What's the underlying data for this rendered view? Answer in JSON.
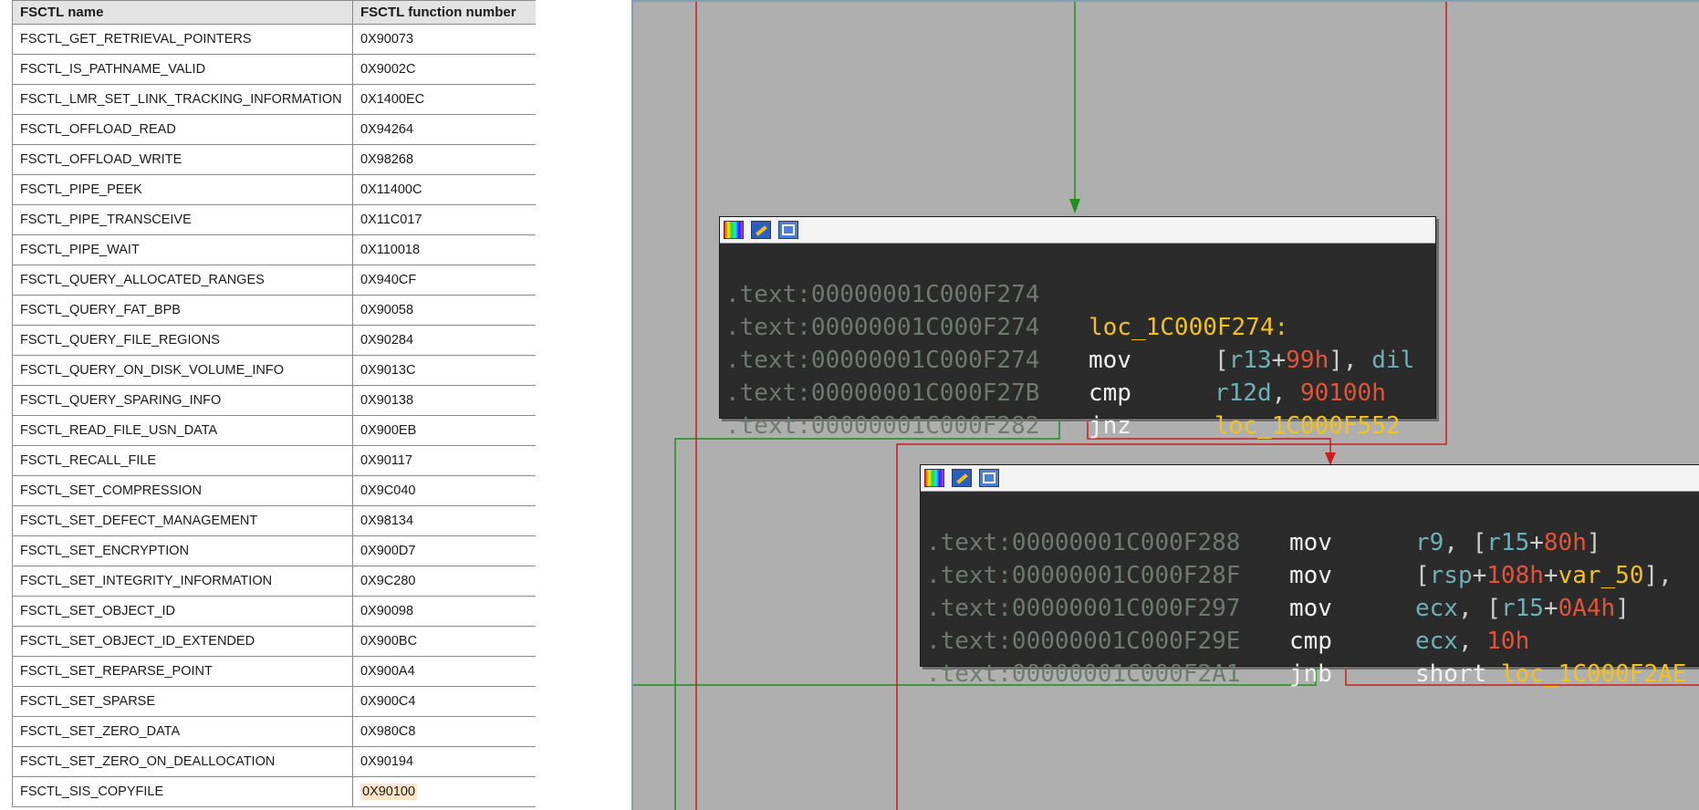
{
  "table": {
    "headers": [
      "FSCTL name",
      "FSCTL function number"
    ],
    "rows": [
      [
        "FSCTL_GET_RETRIEVAL_POINTERS",
        "0X90073"
      ],
      [
        "FSCTL_IS_PATHNAME_VALID",
        "0X9002C"
      ],
      [
        "FSCTL_LMR_SET_LINK_TRACKING_INFORMATION",
        "0X1400EC"
      ],
      [
        "FSCTL_OFFLOAD_READ",
        "0X94264"
      ],
      [
        "FSCTL_OFFLOAD_WRITE",
        "0X98268"
      ],
      [
        "FSCTL_PIPE_PEEK",
        "0X11400C"
      ],
      [
        "FSCTL_PIPE_TRANSCEIVE",
        "0X11C017"
      ],
      [
        "FSCTL_PIPE_WAIT",
        "0X110018"
      ],
      [
        "FSCTL_QUERY_ALLOCATED_RANGES",
        "0X940CF"
      ],
      [
        "FSCTL_QUERY_FAT_BPB",
        "0X90058"
      ],
      [
        "FSCTL_QUERY_FILE_REGIONS",
        "0X90284"
      ],
      [
        "FSCTL_QUERY_ON_DISK_VOLUME_INFO",
        "0X9013C"
      ],
      [
        "FSCTL_QUERY_SPARING_INFO",
        "0X90138"
      ],
      [
        "FSCTL_READ_FILE_USN_DATA",
        "0X900EB"
      ],
      [
        "FSCTL_RECALL_FILE",
        "0X90117"
      ],
      [
        "FSCTL_SET_COMPRESSION",
        "0X9C040"
      ],
      [
        "FSCTL_SET_DEFECT_MANAGEMENT",
        "0X98134"
      ],
      [
        "FSCTL_SET_ENCRYPTION",
        "0X900D7"
      ],
      [
        "FSCTL_SET_INTEGRITY_INFORMATION",
        "0X9C280"
      ],
      [
        "FSCTL_SET_OBJECT_ID",
        "0X90098"
      ],
      [
        "FSCTL_SET_OBJECT_ID_EXTENDED",
        "0X900BC"
      ],
      [
        "FSCTL_SET_REPARSE_POINT",
        "0X900A4"
      ],
      [
        "FSCTL_SET_SPARSE",
        "0X900C4"
      ],
      [
        "FSCTL_SET_ZERO_DATA",
        "0X980C8"
      ],
      [
        "FSCTL_SET_ZERO_ON_DEALLOCATION",
        "0X90194"
      ],
      [
        "FSCTL_SIS_COPYFILE",
        "0X90100"
      ]
    ],
    "highlighted_value": "0X90100",
    "highlight_color": "#fde4c8"
  },
  "graph": {
    "background_color": "#afafaf",
    "edge_colors": {
      "true_branch": "#1f8f1f",
      "false_branch": "#c81e1e"
    },
    "header_icons": [
      "palette-icon",
      "edit-icon",
      "graph-view-icon"
    ],
    "node1": {
      "lines": [
        {
          "addr": ".text:00000001C000F274",
          "label": ""
        },
        {
          "addr": ".text:00000001C000F274",
          "label": "loc_1C000F274:"
        },
        {
          "addr": ".text:00000001C000F274",
          "mnem": "mov",
          "op_a": "[",
          "op_b": "r13",
          "op_c": "+",
          "op_d": "99h",
          "op_e": "], ",
          "op_f": "dil"
        },
        {
          "addr": ".text:00000001C000F27B",
          "mnem": "cmp",
          "op_a": "r12d",
          "op_b": ", ",
          "op_c": "90100h"
        },
        {
          "addr": ".text:00000001C000F282",
          "mnem": "jnz",
          "op_a": "loc_1C000F552"
        }
      ]
    },
    "node2": {
      "lines": [
        {
          "addr": ".text:00000001C000F288",
          "mnem": "mov",
          "op_a": "r9",
          "op_b": ", [",
          "op_c": "r15",
          "op_d": "+",
          "op_e": "80h",
          "op_f": "]"
        },
        {
          "addr": ".text:00000001C000F28F",
          "mnem": "mov",
          "op_a": "[",
          "op_b": "rsp",
          "op_c": "+",
          "op_d": "108h",
          "op_e": "+",
          "op_f": "var_50",
          "op_g": "],"
        },
        {
          "addr": ".text:00000001C000F297",
          "mnem": "mov",
          "op_a": "ecx",
          "op_b": ", [",
          "op_c": "r15",
          "op_d": "+",
          "op_e": "0A4h",
          "op_f": "]"
        },
        {
          "addr": ".text:00000001C000F29E",
          "mnem": "cmp",
          "op_a": "ecx",
          "op_b": ", ",
          "op_c": "10h"
        },
        {
          "addr": ".text:00000001C000F2A1",
          "mnem": "jnb",
          "op_a": "short ",
          "op_b": "loc_1C000F2AE"
        }
      ]
    }
  }
}
